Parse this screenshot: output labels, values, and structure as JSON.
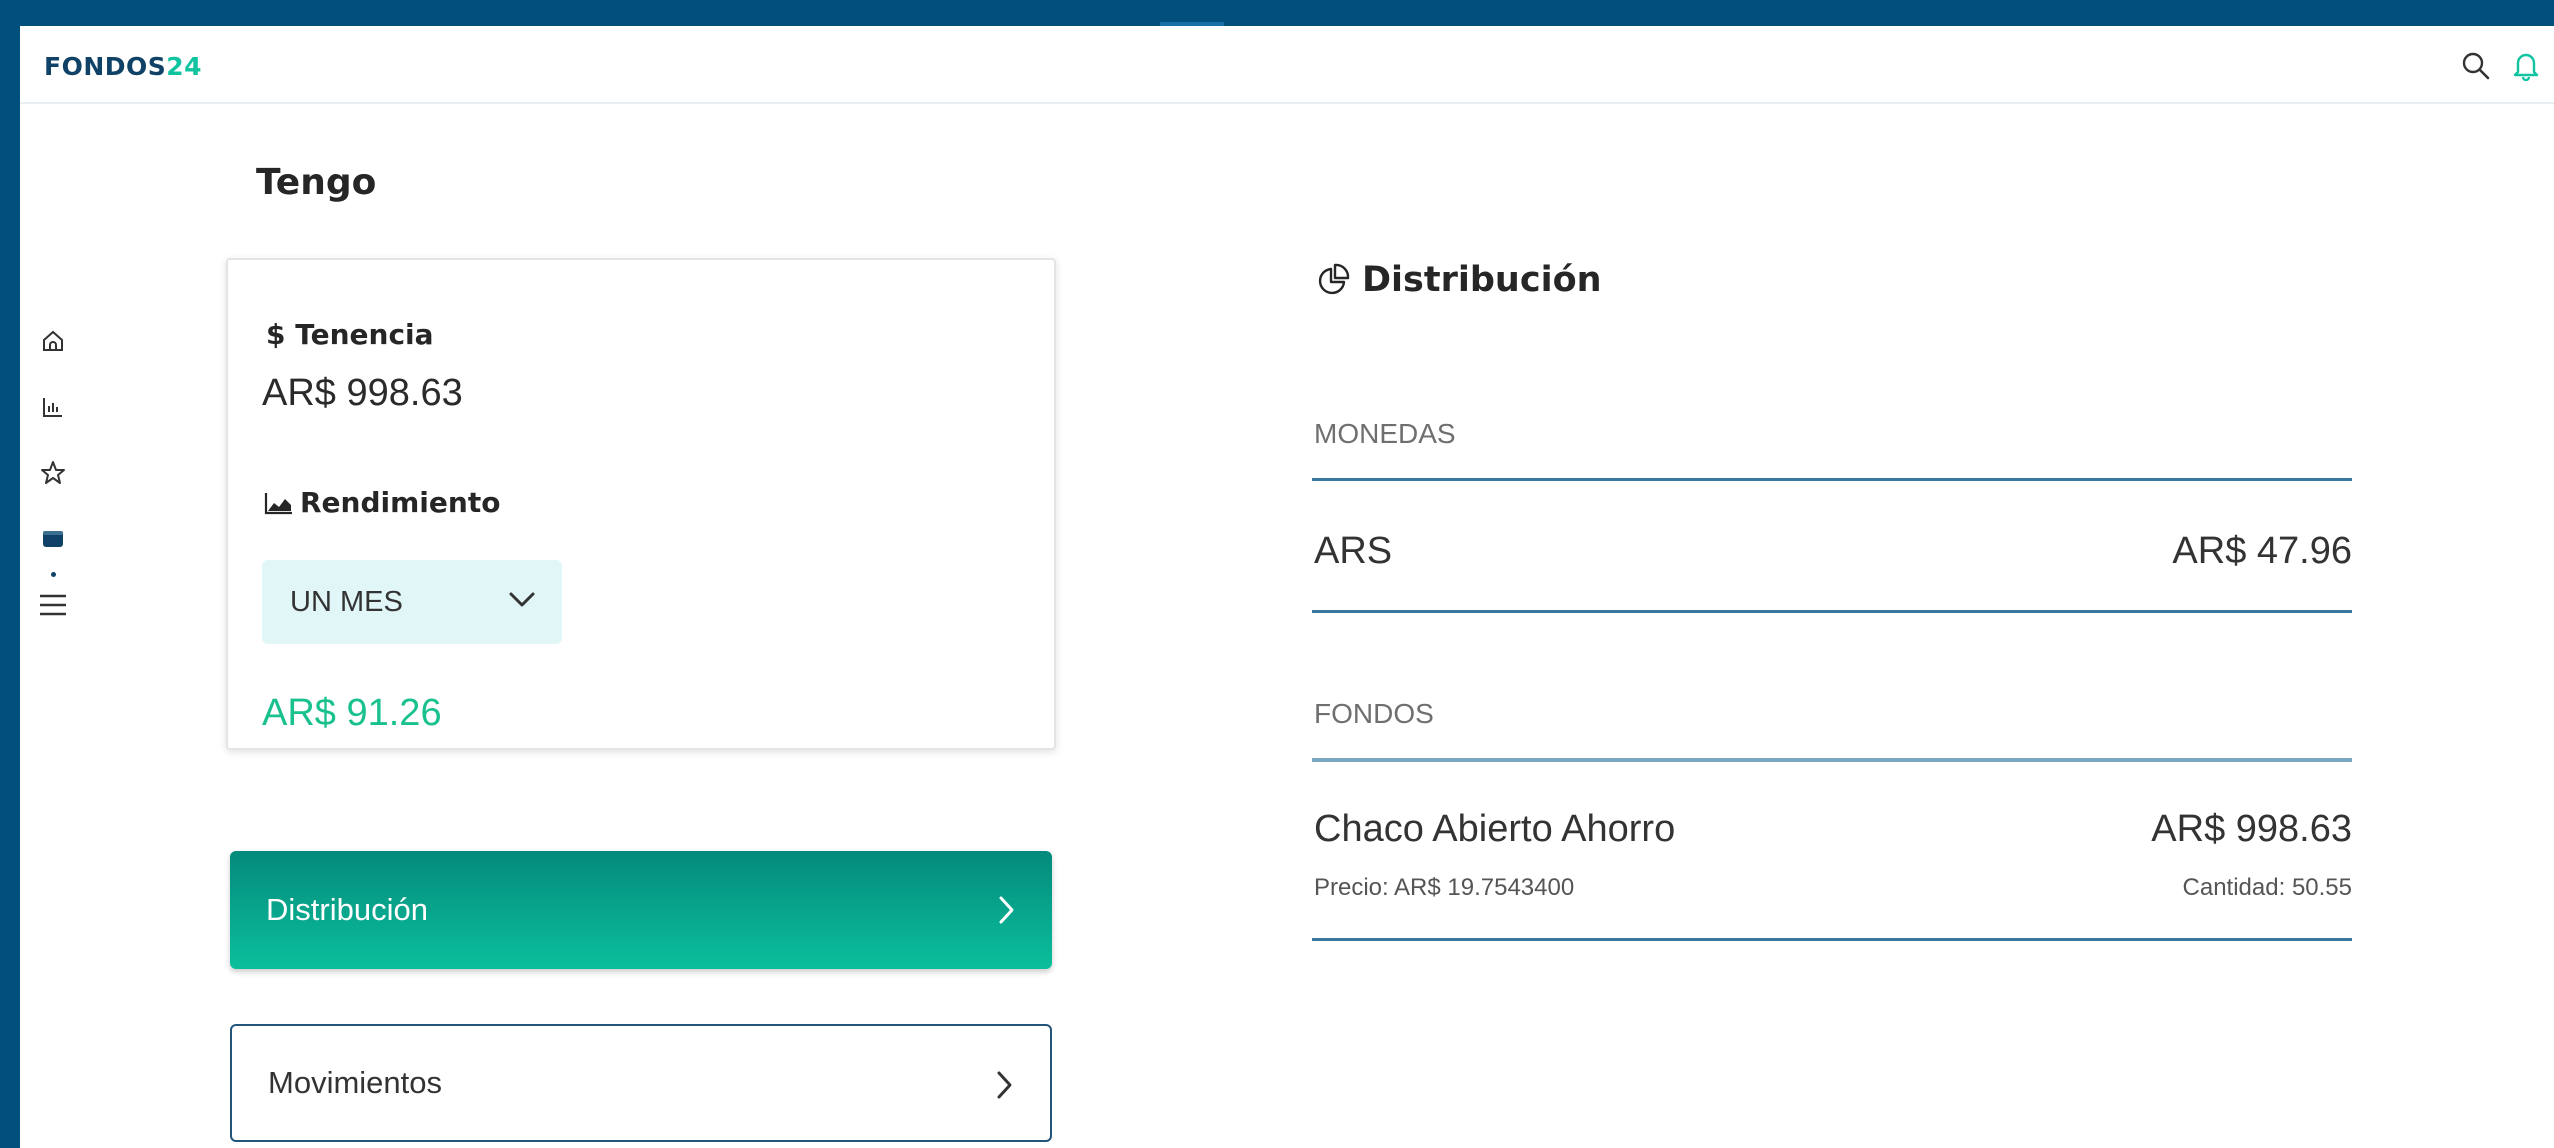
{
  "app": {
    "logo_primary": "FONDOS",
    "logo_accent": "24"
  },
  "header": {
    "icons": [
      "search-icon",
      "bell-icon"
    ]
  },
  "sidebar": {
    "items": [
      "home-icon",
      "chart-icon",
      "star-icon",
      "wallet-icon",
      "menu-icon"
    ],
    "active": "wallet-icon"
  },
  "page": {
    "title": "Tengo"
  },
  "holdings": {
    "tenencia_label": "$ Tenencia",
    "tenencia_value": "AR$ 998.63",
    "rendimiento_label": "Rendimiento",
    "period_selected": "UN MES",
    "rendimiento_value": "AR$ 91.26"
  },
  "buttons": {
    "distribucion": "Distribución",
    "movimientos": "Movimientos"
  },
  "distribution": {
    "title": "Distribución",
    "monedas": {
      "label": "MONEDAS",
      "rows": [
        {
          "name": "ARS",
          "amount": "AR$ 47.96"
        }
      ]
    },
    "fondos": {
      "label": "FONDOS",
      "rows": [
        {
          "name": "Chaco Abierto Ahorro",
          "amount": "AR$ 998.63",
          "price": "Precio: AR$ 19.7543400",
          "quantity": "Cantidad: 50.55"
        }
      ]
    }
  },
  "colors": {
    "brand": "#004f7c",
    "accent": "#11c4a0",
    "positive": "#19c18e"
  }
}
